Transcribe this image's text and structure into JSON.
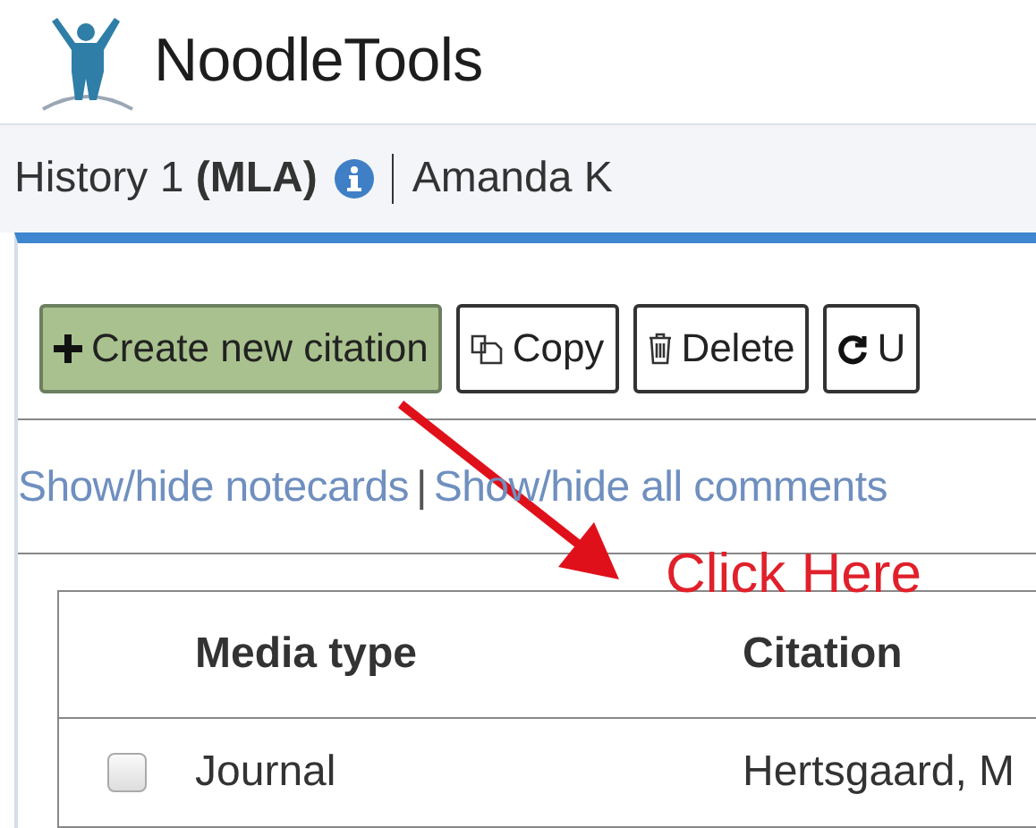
{
  "app": {
    "name": "NoodleTools"
  },
  "project": {
    "title": "History 1 **(MLA)**",
    "owner": "Amanda K"
  },
  "toolbar": [
    {
      "kind": "create",
      "label": "Create new citation"
    },
    {
      "kind": "copy",
      "label": "Copy"
    },
    {
      "kind": "delete",
      "label": "Delete"
    },
    {
      "kind": "undo",
      "label": "U"
    }
  ],
  "links": [
    "Show/hide notecards",
    "Show/hide all comments"
  ],
  "link_separator": "|",
  "annotation": {
    "text": "Click Here"
  },
  "table": {
    "columns": [
      "Media type",
      "Citation"
    ],
    "rows": [
      {
        "checked": false,
        "media_type": "Journal",
        "citation": "Hertsgaard, M"
      }
    ]
  }
}
